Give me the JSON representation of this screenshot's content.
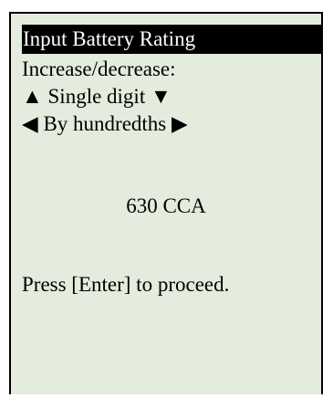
{
  "screen": {
    "title": "Input Battery Rating",
    "instruction": "Increase/decrease:",
    "single_digit_label": "Single digit",
    "hundredths_label": "By hundredths",
    "rating_value": "630 CCA",
    "prompt": "Press [Enter] to proceed."
  },
  "icons": {
    "up": "▲",
    "down": "▼",
    "left": "◀",
    "right": "▶"
  },
  "colors": {
    "screen_background": "#e3ecdd",
    "title_background": "#000000",
    "title_text": "#ffffff",
    "text": "#000000"
  }
}
